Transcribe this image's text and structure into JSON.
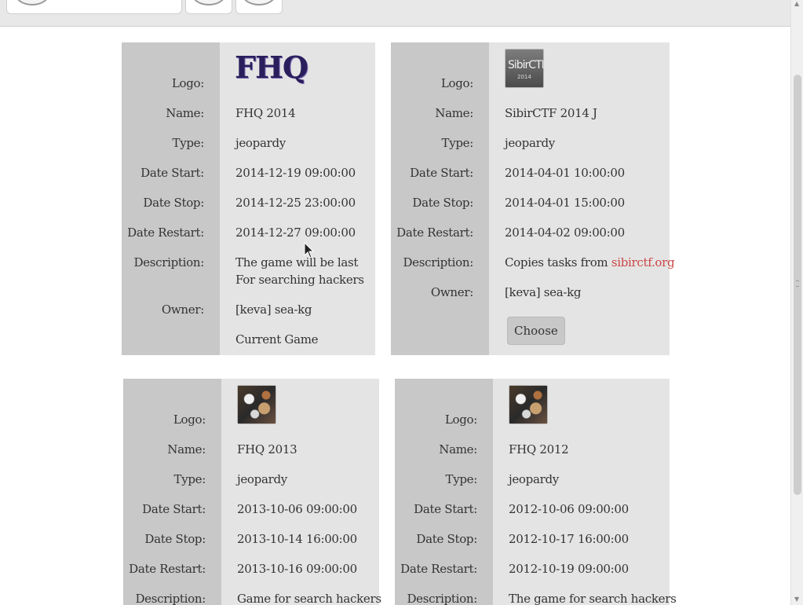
{
  "labels": {
    "logo": "Logo:",
    "name": "Name:",
    "type": "Type:",
    "date_start": "Date Start:",
    "date_stop": "Date Stop:",
    "date_restart": "Date Restart:",
    "description": "Description:",
    "owner": "Owner:"
  },
  "games": [
    {
      "logo_text": "FHQ",
      "name": "FHQ 2014",
      "type": "jeopardy",
      "date_start": "2014-12-19 09:00:00",
      "date_stop": "2014-12-25 23:00:00",
      "date_restart": "2014-12-27 09:00:00",
      "description_line1": "The game will be last",
      "description_line2": "For searching hackers",
      "owner": "[keva] sea-kg",
      "status": "Current Game"
    },
    {
      "logo_text": "SibirCTF",
      "logo_subtext": "2014",
      "name": "SibirCTF 2014 J",
      "type": "jeopardy",
      "date_start": "2014-04-01 10:00:00",
      "date_stop": "2014-04-01 15:00:00",
      "date_restart": "2014-04-02 09:00:00",
      "description_prefix": "Copies tasks from ",
      "description_link": "sibirctf.org",
      "owner": "[keva] sea-kg",
      "choose_label": "Choose"
    },
    {
      "name": "FHQ 2013",
      "type": "jeopardy",
      "date_start": "2013-10-06 09:00:00",
      "date_stop": "2013-10-14 16:00:00",
      "date_restart": "2013-10-16 09:00:00",
      "description": "Game for search hackers"
    },
    {
      "name": "FHQ 2012",
      "type": "jeopardy",
      "date_start": "2012-10-06 09:00:00",
      "date_stop": "2012-10-17 16:00:00",
      "date_restart": "2012-10-19 09:00:00",
      "description": "The game for search hackers"
    }
  ],
  "colors": {
    "link": "#cc4444",
    "card_bg": "#e4e4e4",
    "label_bg": "#c8c8c8",
    "topbar_bg": "#e8e8e8"
  }
}
